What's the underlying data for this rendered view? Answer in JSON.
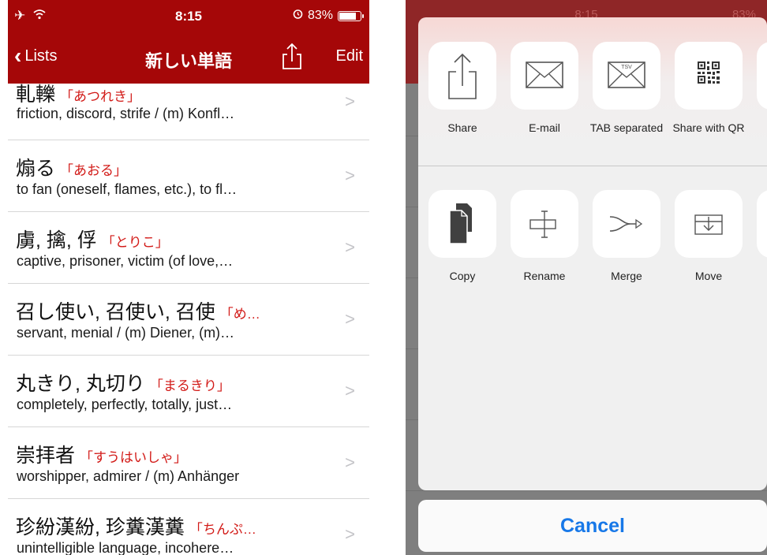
{
  "status_bar": {
    "time": "8:15",
    "battery": "83%",
    "battery_level": 0.83
  },
  "nav": {
    "back_label": "Lists",
    "title": "新しい単語",
    "edit_label": "Edit"
  },
  "entries": [
    {
      "kanji": "軋轢",
      "reading": "「あつれき」",
      "meaning": "friction, discord, strife / (m) Konfl…"
    },
    {
      "kanji": "煽る",
      "reading": "「あおる」",
      "meaning": "to fan (oneself, flames, etc.), to fl…"
    },
    {
      "kanji": "虜, 擒, 俘",
      "reading": "「とりこ」",
      "meaning": "captive, prisoner, victim (of love,…"
    },
    {
      "kanji": "召し使い, 召使い, 召使",
      "reading": "「め…",
      "meaning": "servant, menial / (m) Diener, (m)…"
    },
    {
      "kanji": "丸きり, 丸切り",
      "reading": "「まるきり」",
      "meaning": "completely, perfectly, totally, just…"
    },
    {
      "kanji": "崇拝者",
      "reading": "「すうはいしゃ」",
      "meaning": "worshipper, admirer / (m) Anhänger"
    },
    {
      "kanji": "珍紛漢紛, 珍糞漢糞",
      "reading": "「ちんぷ…",
      "meaning": "unintelligible language, incohere…"
    }
  ],
  "background_status": {
    "time": "8:15",
    "battery": "83%"
  },
  "share_sheet": {
    "row1": [
      {
        "icon": "share-icon",
        "label": "Share"
      },
      {
        "icon": "email-icon",
        "label": "E-mail"
      },
      {
        "icon": "tsv-envelope-icon",
        "label": "TAB separated",
        "badge": "TSV"
      },
      {
        "icon": "qr-code-icon",
        "label": "Share with QR"
      }
    ],
    "row2": [
      {
        "icon": "copy-icon",
        "label": "Copy"
      },
      {
        "icon": "rename-icon",
        "label": "Rename"
      },
      {
        "icon": "merge-icon",
        "label": "Merge"
      },
      {
        "icon": "move-icon",
        "label": "Move"
      },
      {
        "icon": "partial-tile-icon",
        "label": "C"
      }
    ],
    "cancel_label": "Cancel",
    "accent_color": "#1778e8"
  },
  "colors": {
    "nav_red": "#a50708",
    "reading_red": "#d21a17"
  }
}
